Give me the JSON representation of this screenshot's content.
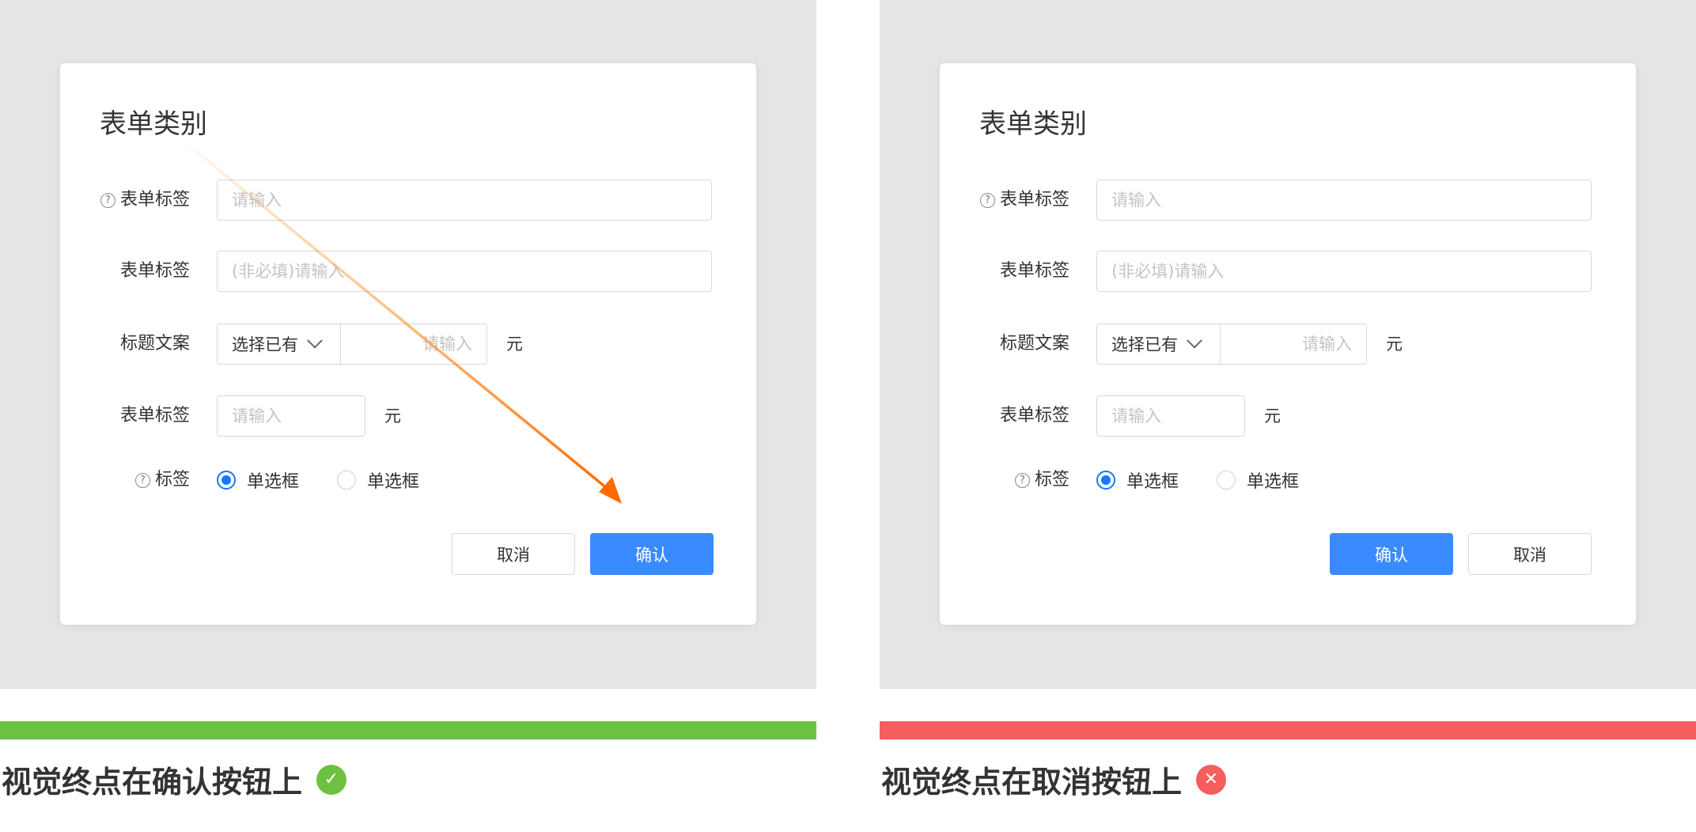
{
  "colors": {
    "good": "#6cc141",
    "bad": "#f65d5d",
    "primary": "#3a8bff",
    "arrow": "#ff6a00"
  },
  "panels": [
    {
      "id": "good",
      "dialog": {
        "title": "表单类别",
        "fields": {
          "label1": "表单标签",
          "placeholder1": "请输入",
          "label2": "表单标签",
          "placeholder2": "(非必填)请输入",
          "label3": "标题文案",
          "select3": "选择已有",
          "placeholder3": "请输入",
          "unit3": "元",
          "label4": "表单标签",
          "placeholder4": "请输入",
          "unit4": "元",
          "label5": "标签",
          "radio1": "单选框",
          "radio2": "单选框"
        },
        "cancel_label": "取消",
        "confirm_label": "确认"
      },
      "caption": "视觉终点在确认按钮上",
      "status_icon": "check-circle-icon"
    },
    {
      "id": "bad",
      "dialog": {
        "title": "表单类别",
        "fields": {
          "label1": "表单标签",
          "placeholder1": "请输入",
          "label2": "表单标签",
          "placeholder2": "(非必填)请输入",
          "label3": "标题文案",
          "select3": "选择已有",
          "placeholder3": "请输入",
          "unit3": "元",
          "label4": "表单标签",
          "placeholder4": "请输入",
          "unit4": "元",
          "label5": "标签",
          "radio1": "单选框",
          "radio2": "单选框"
        },
        "cancel_label": "取消",
        "confirm_label": "确认"
      },
      "caption": "视觉终点在取消按钮上",
      "status_icon": "close-circle-icon"
    }
  ]
}
